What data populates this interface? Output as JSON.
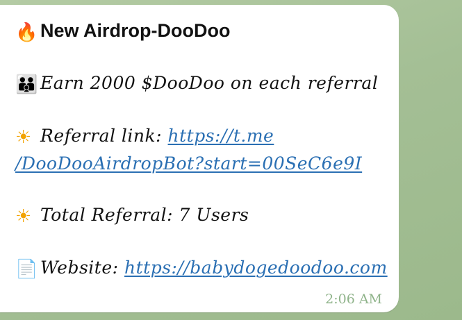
{
  "message": {
    "title": "New Airdrop-DooDoo",
    "title_icon": "fire-icon",
    "earn_text": "Earn 2000 $DooDoo on each referral",
    "earn_icon": "family-icon",
    "referral_label": "Referral link: ",
    "referral_link_part1": "https://t.me",
    "referral_link_part2": "/DooDooAirdropBot?start=00SeC6e9I",
    "referral_icon": "sun-icon",
    "total_label": "Total Referral: 7 Users",
    "total_icon": "sun-icon",
    "website_label": "Website: ",
    "website_link": "https://babydogedoodoo.com",
    "website_icon": "page-icon",
    "time": "2:06 AM"
  },
  "colors": {
    "bubble_bg": "#ffffff",
    "chat_bg": "#a8c29a",
    "link": "#2a6fb3",
    "time": "#8fb38a"
  }
}
